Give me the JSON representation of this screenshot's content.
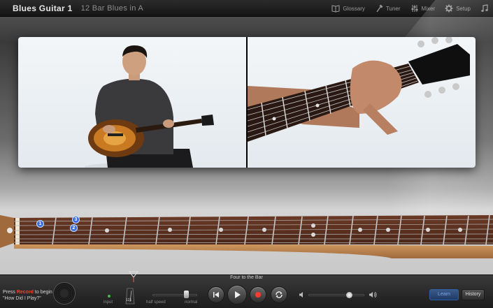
{
  "header": {
    "title": "Blues Guitar 1",
    "subtitle": "12 Bar Blues in A",
    "nav": [
      {
        "label": "Glossary",
        "icon": "book-icon"
      },
      {
        "label": "Tuner",
        "icon": "tuning-fork-icon"
      },
      {
        "label": "Mixer",
        "icon": "mixer-icon"
      },
      {
        "label": "Setup",
        "icon": "gear-icon"
      },
      {
        "label": "",
        "icon": "music-note-icon"
      }
    ]
  },
  "fretboard": {
    "finger_markers": [
      "1",
      "3",
      "2"
    ]
  },
  "transport": {
    "song_label": "Four to the Bar",
    "record_hint_prefix": "Press ",
    "record_hint_word": "Record",
    "record_hint_suffix": " to begin",
    "record_hint_line2": "\"How Did I Play?\"",
    "input_label": "input",
    "metronome_value": "121",
    "half_speed_label": "half speed",
    "normal_label": "normal",
    "speed_level": 0.75,
    "volume_level": 0.72
  },
  "buttons": {
    "learn": "Learn",
    "history": "History"
  },
  "colors": {
    "record_red": "#ff3b30",
    "learn_blue": "#7fa7e6",
    "marker_blue": "#3a6ed8"
  }
}
